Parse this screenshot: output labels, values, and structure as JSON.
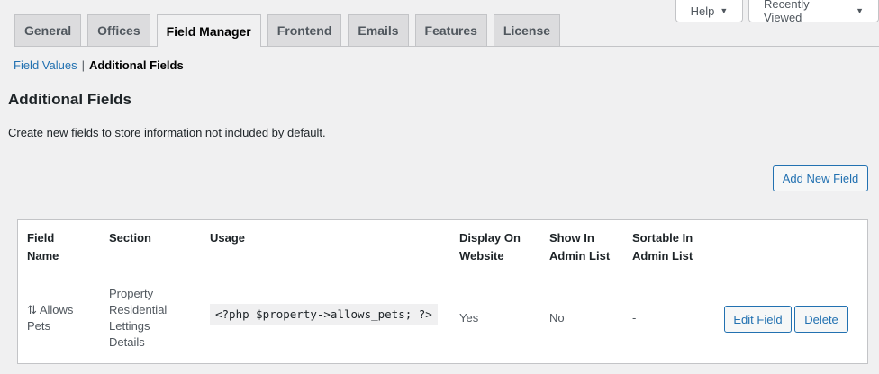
{
  "top_actions": {
    "help_label": "Help",
    "recent_label": "Recently Viewed"
  },
  "tabs": [
    {
      "label": "General"
    },
    {
      "label": "Offices"
    },
    {
      "label": "Field Manager"
    },
    {
      "label": "Frontend"
    },
    {
      "label": "Emails"
    },
    {
      "label": "Features"
    },
    {
      "label": "License"
    }
  ],
  "active_tab": "Field Manager",
  "subnav": {
    "link": "Field Values",
    "separator": "|",
    "current": "Additional Fields"
  },
  "page": {
    "title": "Additional Fields",
    "description": "Create new fields to store information not included by default.",
    "add_button": "Add New Field"
  },
  "table": {
    "headers": {
      "name_1": "Field",
      "name_2": "Name",
      "section": "Section",
      "usage": "Usage",
      "display_1": "Display On",
      "display_2": "Website",
      "admin_1": "Show In",
      "admin_2": "Admin List",
      "sortable_1": "Sortable In",
      "sortable_2": "Admin List"
    },
    "rows": [
      {
        "drag_icon": "sort-arrows-icon",
        "drag_glyph": "⇅",
        "name_1": "Allows",
        "name_2": "Pets",
        "section_1": "Property",
        "section_2": "Residential",
        "section_3": "Lettings",
        "section_4": "Details",
        "usage": "<?php $property->allows_pets; ?>",
        "display": "Yes",
        "show_admin": "No",
        "sortable": "-",
        "edit_label": "Edit Field",
        "delete_label": "Delete"
      }
    ]
  },
  "colors": {
    "accent": "#2271b1",
    "background": "#f0f0f1",
    "border": "#c3c4c7"
  }
}
